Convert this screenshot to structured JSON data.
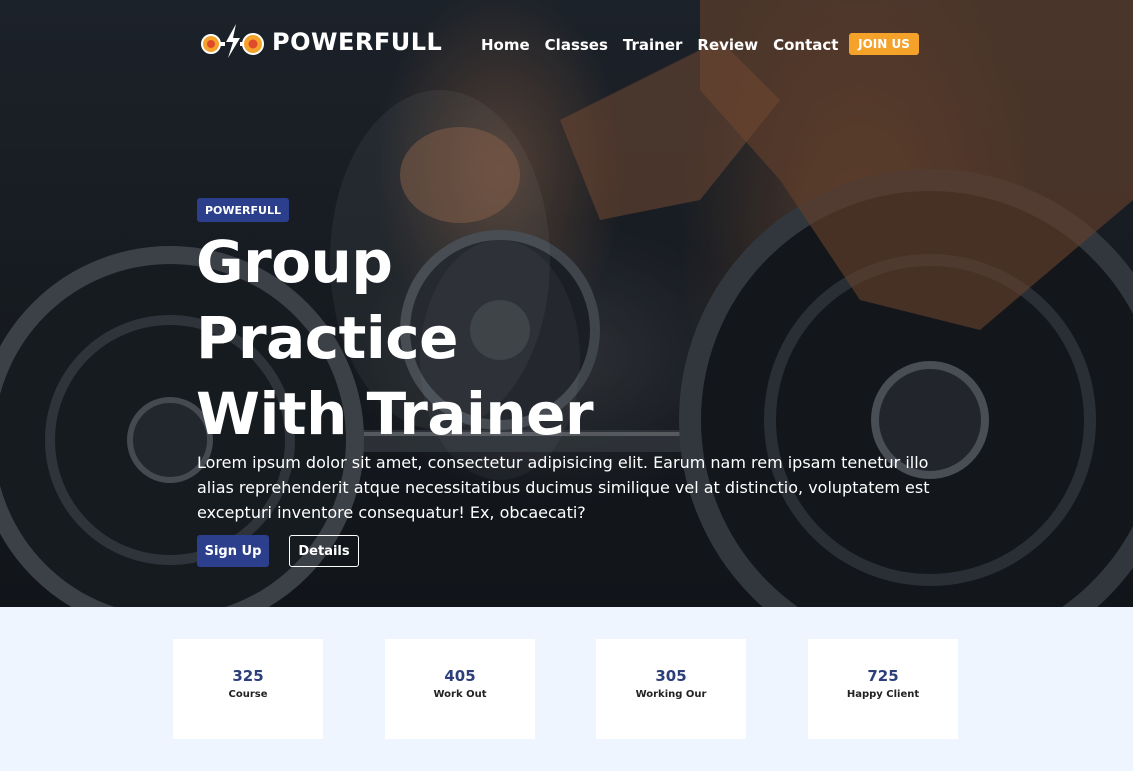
{
  "brand": {
    "name": "POWERFULL"
  },
  "nav": {
    "items": [
      {
        "label": "Home"
      },
      {
        "label": "Classes"
      },
      {
        "label": "Trainer"
      },
      {
        "label": "Review"
      },
      {
        "label": "Contact"
      }
    ],
    "cta_label": "JOIN US"
  },
  "hero": {
    "badge": "POWERFULL",
    "headline_lines": [
      "Group",
      "Practice",
      "With Trainer"
    ],
    "description": "Lorem ipsum dolor sit amet, consectetur adipisicing elit. Earum nam rem ipsam tenetur illo alias reprehenderit atque necessitatibus ducimus similique vel at distinctio, voluptatem est excepturi inventore consequatur! Ex, obcaecati?",
    "primary_button": "Sign Up",
    "secondary_button": "Details",
    "background_icon": "barbell-photo"
  },
  "stats": [
    {
      "value": "325",
      "label": "Course"
    },
    {
      "value": "405",
      "label": "Work Out"
    },
    {
      "value": "305",
      "label": "Working Our"
    },
    {
      "value": "725",
      "label": "Happy Client"
    }
  ],
  "colors": {
    "accent_blue": "#2c3f8d",
    "accent_orange": "#f5a22a",
    "stats_bg": "#eef5ff",
    "stat_number": "#2c3f7a"
  }
}
